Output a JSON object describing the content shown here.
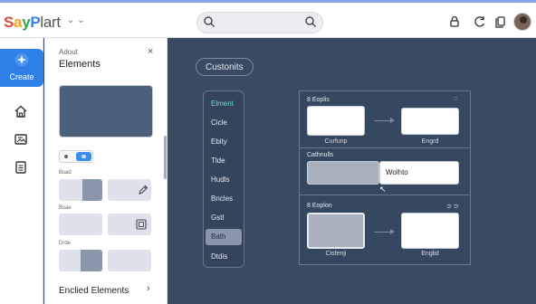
{
  "app": {
    "logo": {
      "p1": "S",
      "p2": "a",
      "p3": "y",
      "p4": "P",
      "p5": "lart"
    },
    "logo_caret": "⌄ ⌄"
  },
  "topbar": {
    "icons": [
      "search-icon",
      "search-icon",
      "lock-icon",
      "refresh-icon",
      "copy-icon"
    ]
  },
  "rail": {
    "create_label": "Create",
    "items": [
      "home-icon",
      "image-icon",
      "document-icon"
    ]
  },
  "panel": {
    "subtitle": "Adout",
    "title": "Elements",
    "close": "×",
    "sections": [
      "Bsad",
      "Bsae",
      "Drde"
    ],
    "footer": "Enclied Elements",
    "footer_chevron": "›"
  },
  "canvas": {
    "title": "Custonits",
    "menu": [
      "Elment",
      "Cicle",
      "Ebity",
      "Tlde",
      "Hudls",
      "Bncles",
      "Gstl",
      "Bath",
      "Dtdis"
    ],
    "menu_active_index": 7,
    "frame": {
      "top_label": "8  Eoplis",
      "top_label_right": "◌",
      "row1_captions": [
        "Curfunp",
        "Engrd"
      ],
      "mid_label": "Cathnulls",
      "mid_box_text": "Wolhto",
      "bottom_label": "8  Eoplon",
      "bottom_label_right": "⊃ ⊃",
      "row3_captions": [
        "Cisfenji",
        "Englid"
      ]
    }
  },
  "colors": {
    "accent": "#2f7fe8",
    "canvas_bg": "#3a4a62",
    "menu_first": "#6cd8c9"
  }
}
